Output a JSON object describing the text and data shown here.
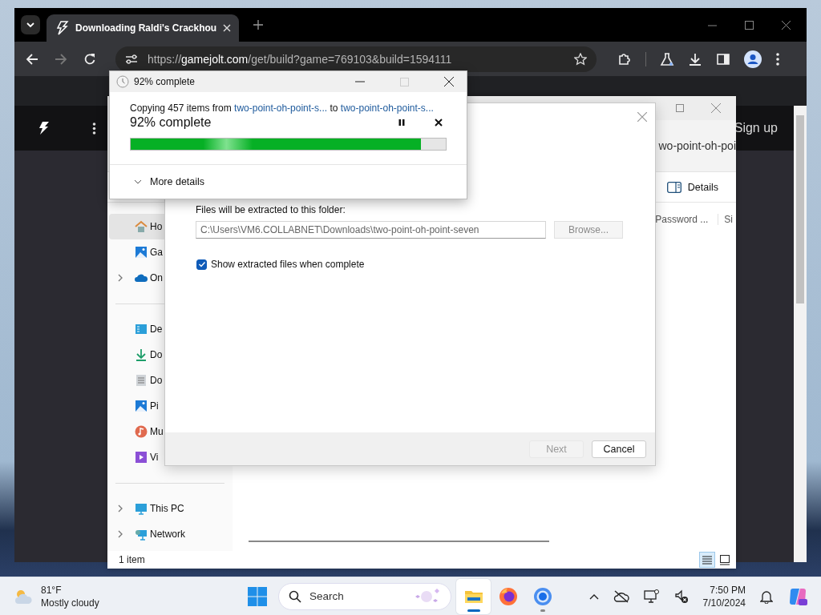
{
  "browser": {
    "tab": {
      "title": "Downloading Raldi's Crackhou",
      "selected": true
    },
    "url": {
      "scheme": "https://",
      "host": "gamejolt.com",
      "path": "/get/build?game=769103&build=1594111"
    },
    "page": {
      "signup": "Sign up"
    }
  },
  "explorer": {
    "address": "wo-point-oh-poi",
    "details_button": "Details",
    "columns": [
      "Password ...",
      "Si"
    ],
    "nav_sections": [
      [
        {
          "kind": "home",
          "label": "Ho",
          "expandable": false,
          "selected": true
        },
        {
          "kind": "gallery",
          "label": "Ga",
          "expandable": false,
          "selected": false
        },
        {
          "kind": "cloud",
          "label": "On",
          "expandable": true,
          "selected": false
        }
      ],
      [
        {
          "kind": "desktop",
          "label": "De",
          "expandable": false,
          "selected": false
        },
        {
          "kind": "downloads",
          "label": "Do",
          "expandable": false,
          "selected": false
        },
        {
          "kind": "documents",
          "label": "Do",
          "expandable": false,
          "selected": false
        },
        {
          "kind": "pictures",
          "label": "Pi",
          "expandable": false,
          "selected": false
        },
        {
          "kind": "music",
          "label": "Mu",
          "expandable": false,
          "selected": false
        },
        {
          "kind": "videos",
          "label": "Vi",
          "expandable": false,
          "selected": false
        }
      ],
      [
        {
          "kind": "pc",
          "label": "This PC",
          "expandable": true,
          "selected": false
        },
        {
          "kind": "network",
          "label": "Network",
          "expandable": true,
          "selected": false
        }
      ]
    ],
    "status": "1 item",
    "views": [
      {
        "kind": "details",
        "selected": true
      },
      {
        "kind": "tiles",
        "selected": false
      }
    ]
  },
  "extract_dialog": {
    "folder_label": "Files will be extracted to this folder:",
    "path": "C:\\Users\\VM6.COLLABNET\\Downloads\\two-point-oh-point-seven",
    "browse": {
      "label": "Browse...",
      "disabled": true
    },
    "show_files": {
      "label": "Show extracted files when complete",
      "checked": true
    },
    "buttons": [
      {
        "label": "Next",
        "disabled": true
      },
      {
        "label": "Cancel",
        "disabled": false
      }
    ]
  },
  "copy_dialog": {
    "title": "92% complete",
    "prefix": "Copying 457 items from",
    "source": "two-point-oh-point-s...",
    "middle": "to",
    "destination": "two-point-oh-point-s...",
    "progress_text": "92% complete",
    "level": 0.92,
    "more_details": {
      "label": "More details",
      "expanded": false
    }
  },
  "taskbar": {
    "weather": {
      "temp": "81°F",
      "condition": "Mostly cloudy"
    },
    "search": {
      "placeholder": "Search"
    },
    "apps": [
      {
        "kind": "explorer",
        "running": true,
        "active": true
      },
      {
        "kind": "firefox",
        "running": false,
        "active": false
      },
      {
        "kind": "chrome",
        "running": true,
        "active": false
      }
    ],
    "time": "7:50 PM",
    "date": "7/10/2024"
  }
}
